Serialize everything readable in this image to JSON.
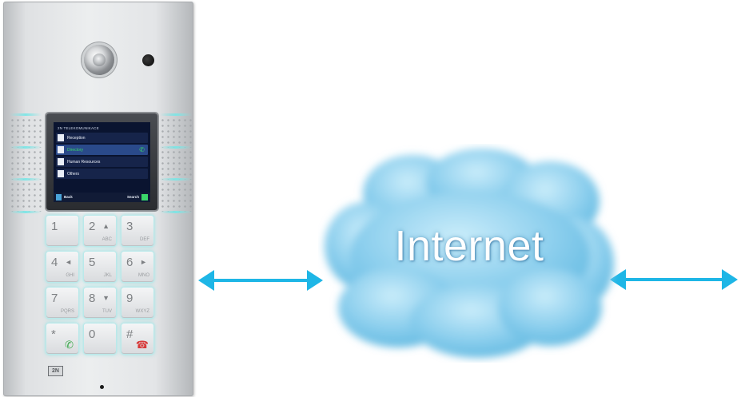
{
  "cloud": {
    "label": "Internet"
  },
  "intercom": {
    "logo": "2N",
    "display": {
      "title": "2N TELEKOMUNIKACE",
      "items": [
        {
          "label": "Reception",
          "selected": false
        },
        {
          "label": "Directory",
          "selected": true
        },
        {
          "label": "Human Resources",
          "selected": false
        },
        {
          "label": "Others",
          "selected": false
        }
      ],
      "left_softkey": "Back",
      "right_softkey": "Search"
    },
    "keys": [
      {
        "num": "1",
        "sub": ""
      },
      {
        "num": "2",
        "sub": "ABC"
      },
      {
        "num": "3",
        "sub": "DEF"
      },
      {
        "num": "4",
        "sub": "GHI"
      },
      {
        "num": "5",
        "sub": "JKL"
      },
      {
        "num": "6",
        "sub": "MNO"
      },
      {
        "num": "7",
        "sub": "PQRS"
      },
      {
        "num": "8",
        "sub": "TUV"
      },
      {
        "num": "9",
        "sub": "WXYZ"
      },
      {
        "num": "*",
        "sub": ""
      },
      {
        "num": "0",
        "sub": ""
      },
      {
        "num": "#",
        "sub": ""
      }
    ]
  },
  "colors": {
    "arrow": "#1eb6e6",
    "cloud_light": "#bfe6f7",
    "cloud_dark": "#5fb8e0",
    "key_glow": "#78e1e1"
  }
}
